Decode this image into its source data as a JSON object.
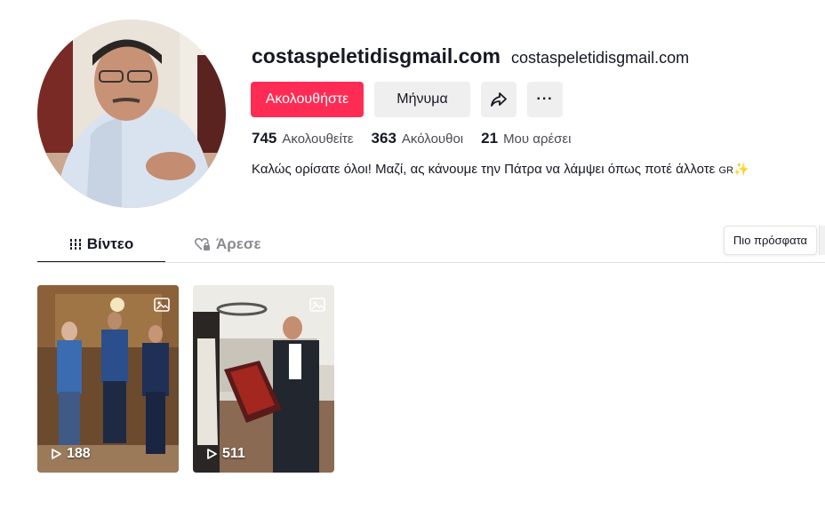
{
  "profile": {
    "username": "costaspeletidisgmail.com",
    "nickname": "costaspeletidisgmail.com",
    "bio_text": "Καλώς ορίσατε όλοι! Μαζί, ας κάνουμε την Πάτρα να λάμψει όπως ποτέ άλλοτε",
    "bio_flag": "GR",
    "bio_emoji": "✨"
  },
  "actions": {
    "follow_label": "Ακολουθήστε",
    "message_label": "Μήνυμα",
    "more_label": "···"
  },
  "stats": {
    "following_count": "745",
    "following_label": "Ακολουθείτε",
    "followers_count": "363",
    "followers_label": "Ακόλουθοι",
    "likes_count": "21",
    "likes_label": "Μου αρέσει"
  },
  "tabs": {
    "videos_label": "Βίντεο",
    "liked_label": "Άρεσε"
  },
  "sort": {
    "label": "Πιο πρόσφατα"
  },
  "videos": [
    {
      "views": "188",
      "type": "photo"
    },
    {
      "views": "511",
      "type": "photo"
    }
  ],
  "colors": {
    "accent": "#fe2c55",
    "button_gray": "#efeff0",
    "text": "#161823"
  }
}
